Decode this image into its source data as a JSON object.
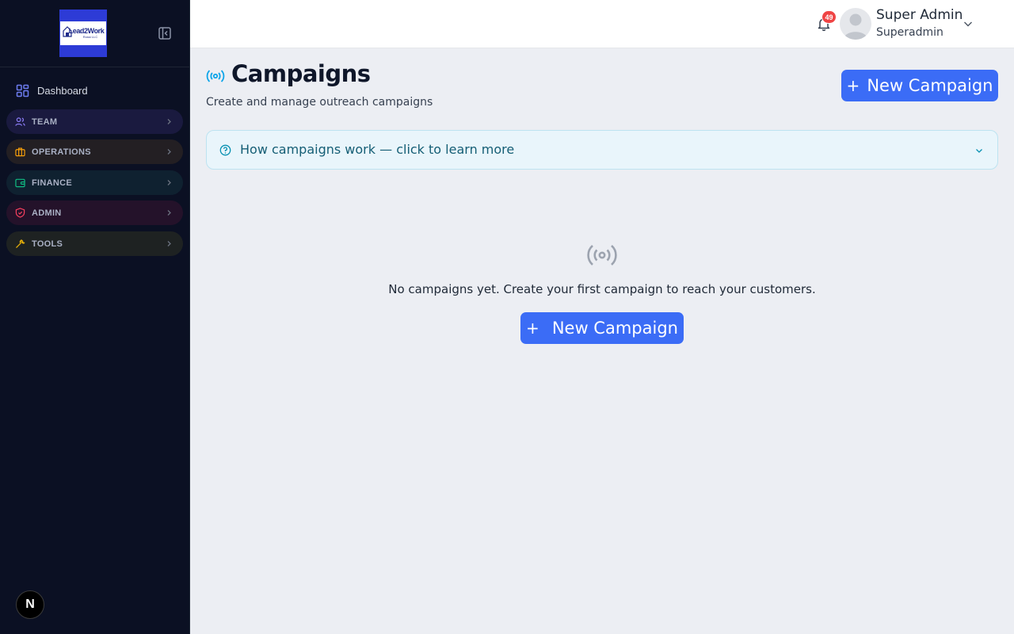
{
  "sidebar": {
    "logo": {
      "brand": "Lead2Work",
      "sub": "Rossi LLC"
    },
    "dashboard_label": "Dashboard",
    "groups": [
      {
        "label": "TEAM",
        "icon": "users-icon",
        "color": "#8b7cf6"
      },
      {
        "label": "OPERATIONS",
        "icon": "briefcase-icon",
        "color": "#f59e0b"
      },
      {
        "label": "FINANCE",
        "icon": "wallet-icon",
        "color": "#10b981"
      },
      {
        "label": "ADMIN",
        "icon": "shield-icon",
        "color": "#f43f5e"
      },
      {
        "label": "TOOLS",
        "icon": "wrench-icon",
        "color": "#eab308"
      }
    ],
    "footer_badge": "N"
  },
  "topbar": {
    "notification_count": "49",
    "user_name": "Super Admin",
    "user_role": "Superadmin"
  },
  "main": {
    "title": "Campaigns",
    "subtitle": "Create and manage outreach campaigns",
    "new_button": "New Campaign",
    "info_bar": "How campaigns work — click to learn more",
    "empty_text": "No campaigns yet. Create your first campaign to reach your customers.",
    "empty_button": "New Campaign"
  },
  "colors": {
    "accent": "#3b6cf6",
    "sidebar_bg": "#0b1023",
    "info_text": "#155e75",
    "badge": "#ef4444"
  }
}
